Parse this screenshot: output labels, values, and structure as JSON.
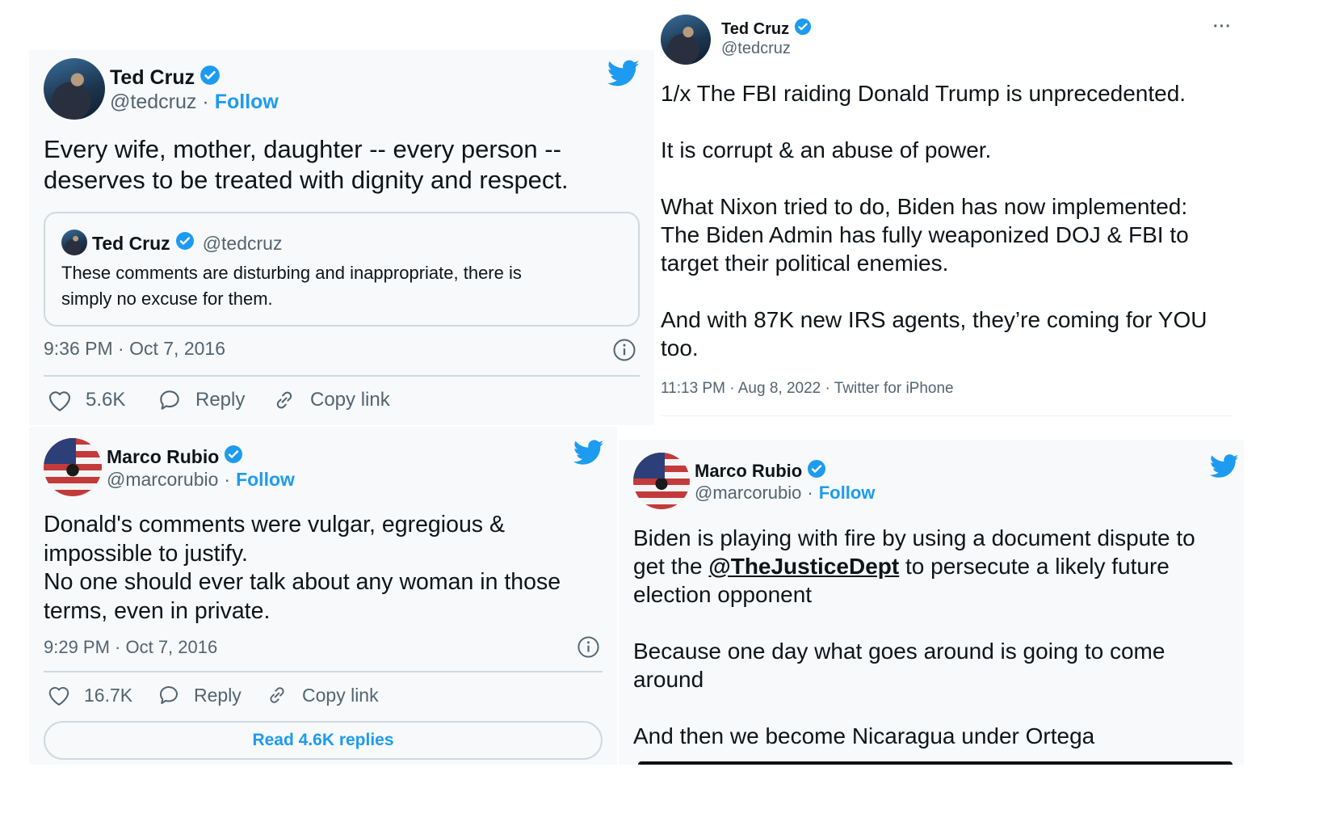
{
  "colors": {
    "accent": "#1d9bf0",
    "text": "#0f1419",
    "secondary": "#536471",
    "border": "#cfd9de"
  },
  "tweet1": {
    "name": "Ted Cruz",
    "handle": "@tedcruz",
    "separator": "·",
    "follow": "Follow",
    "text": "Every wife, mother, daughter -- every person --\ndeserves to be treated with dignity and respect.",
    "quote": {
      "name": "Ted Cruz",
      "handle": "@tedcruz",
      "text": "These comments are disturbing and inappropriate, there is\nsimply no excuse for them."
    },
    "timestamp": "9:36 PM · Oct 7, 2016",
    "likes": "5.6K",
    "reply_label": "Reply",
    "copy_label": "Copy link"
  },
  "tweet2": {
    "name": "Ted Cruz",
    "handle": "@tedcruz",
    "more": "···",
    "text": "1/x The FBI raiding Donald Trump is unprecedented.\n\nIt is corrupt & an abuse of power.\n\nWhat Nixon tried to do, Biden has now implemented:\nThe Biden Admin has fully weaponized DOJ & FBI to\ntarget their political enemies.\n\nAnd with 87K new IRS agents, they’re coming for YOU\ntoo.",
    "meta": "11:13 PM · Aug 8, 2022 · Twitter for iPhone"
  },
  "tweet3": {
    "name": "Marco Rubio",
    "handle": "@marcorubio",
    "separator": "·",
    "follow": "Follow",
    "text": "Donald's comments were vulgar, egregious &\nimpossible to justify.\nNo one should ever talk about any woman in those\nterms, even in private.",
    "timestamp": "9:29 PM · Oct 7, 2016",
    "likes": "16.7K",
    "reply_label": "Reply",
    "copy_label": "Copy link",
    "read_replies": "Read 4.6K replies"
  },
  "tweet4": {
    "name": "Marco Rubio",
    "handle": "@marcorubio",
    "separator": "·",
    "follow": "Follow",
    "text_a": "Biden is playing with fire by using a document dispute to\nget the ",
    "mention": "@TheJusticeDept",
    "text_b": " to persecute a likely future\nelection opponent\n\nBecause one day what goes around is going to come\naround\n\nAnd then we become Nicaragua under Ortega"
  }
}
